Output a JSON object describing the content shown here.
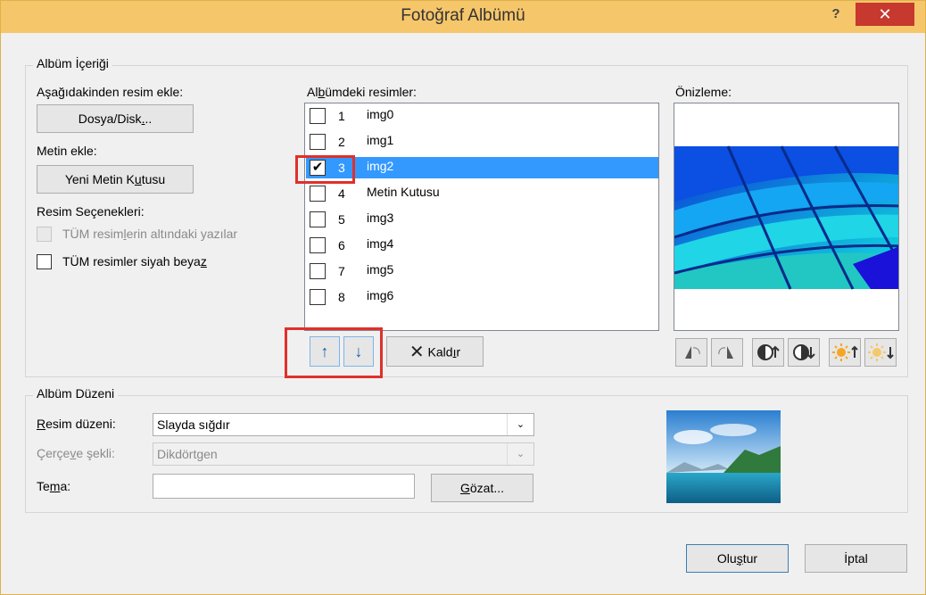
{
  "window": {
    "title": "Fotoğraf Albümü",
    "help": "?",
    "close": "✕"
  },
  "album_content": {
    "group_title": "Albüm İçeriği",
    "insert_from_label": "Aşağıdakinden resim ekle:",
    "file_disk_button": "Dosya/Disk...",
    "insert_text_label": "Metin ekle:",
    "new_textbox_button": "Yeni Metin Kutusu",
    "picture_options_label": "Resim Seçenekleri:",
    "captions_option": "TÜM resimlerin altındaki yazılar",
    "black_white_option": "TÜM resimler siyah beyaz",
    "pictures_in_album_label": "Albümdeki resimler:",
    "pictures": [
      {
        "num": "1",
        "name": "img0",
        "checked": false,
        "selected": false
      },
      {
        "num": "2",
        "name": "img1",
        "checked": false,
        "selected": false
      },
      {
        "num": "3",
        "name": "img2",
        "checked": true,
        "selected": true
      },
      {
        "num": "4",
        "name": "Metin Kutusu",
        "checked": false,
        "selected": false
      },
      {
        "num": "5",
        "name": "img3",
        "checked": false,
        "selected": false
      },
      {
        "num": "6",
        "name": "img4",
        "checked": false,
        "selected": false
      },
      {
        "num": "7",
        "name": "img5",
        "checked": false,
        "selected": false
      },
      {
        "num": "8",
        "name": "img6",
        "checked": false,
        "selected": false
      }
    ],
    "move_up": "↑",
    "move_down": "↓",
    "remove_button": "Kaldır",
    "preview_label": "Önizleme:"
  },
  "album_layout": {
    "group_title": "Albüm Düzeni",
    "picture_layout_label": "Resim düzeni:",
    "picture_layout_value": "Slayda sığdır",
    "frame_shape_label": "Çerçeve şekli:",
    "frame_shape_value": "Dikdörtgen",
    "theme_label": "Tema:",
    "theme_value": "",
    "browse_button": "Gözat..."
  },
  "footer": {
    "create_button": "Oluştur",
    "cancel_button": "İptal"
  },
  "colors": {
    "selection": "#3399ff",
    "titlebar": "#f6c66a",
    "close": "#c7382e",
    "highlight_box": "#e0302b"
  }
}
